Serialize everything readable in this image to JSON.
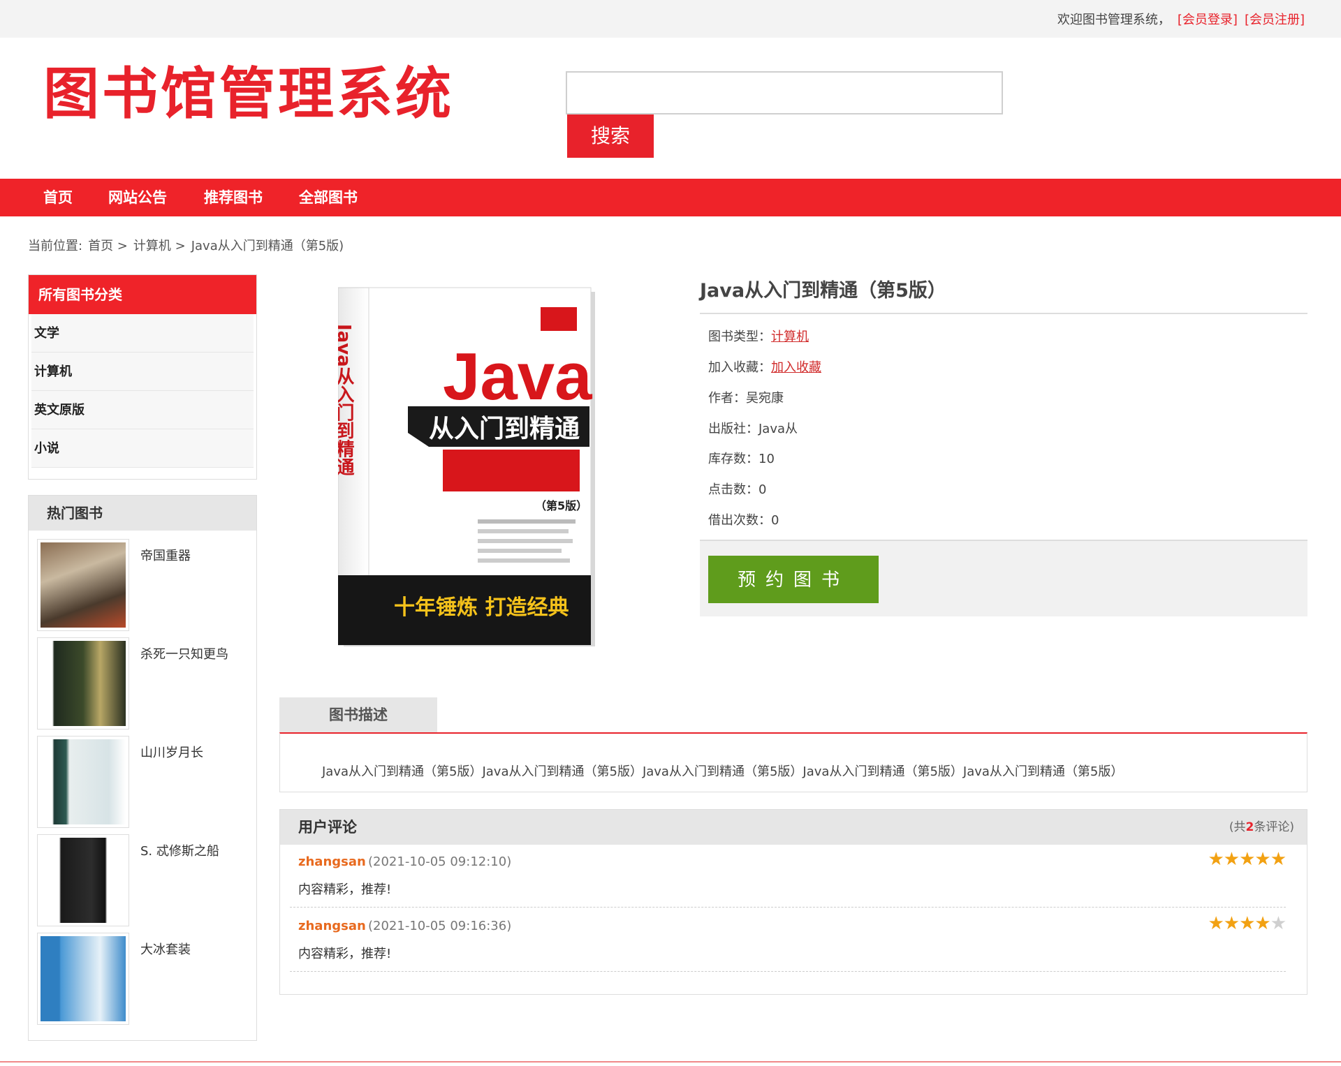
{
  "topbar": {
    "welcome": "欢迎图书管理系统，",
    "login": "[会员登录]",
    "register": "[会员注册]"
  },
  "header": {
    "logo_text": "图书馆管理系统",
    "search_placeholder": "",
    "search_button": "搜索"
  },
  "nav": {
    "items": [
      "首页",
      "网站公告",
      "推荐图书",
      "全部图书"
    ]
  },
  "breadcrumb": {
    "prefix": "当前位置:",
    "items": [
      "首页 >",
      "计算机 >",
      "Java从入门到精通（第5版)"
    ]
  },
  "sidebar": {
    "categories_title": "所有图书分类",
    "categories": [
      "文学",
      "计算机",
      "英文原版",
      "小说"
    ],
    "hot_title": "热门图书",
    "hot_books": [
      "帝国重器",
      "杀死一只知更鸟",
      "山川岁月长",
      "S. 忒修斯之船",
      "大冰套装"
    ]
  },
  "book": {
    "title": "Java从入门到精通（第5版）",
    "type_label": "图书类型：",
    "type_value": "计算机",
    "fav_label": "加入收藏：",
    "fav_value": "加入收藏",
    "author": "作者：吴宛康",
    "publisher": "出版社：Java从",
    "stock": "库存数：10",
    "clicks": "点击数：0",
    "borrows": "借出次数：0",
    "reserve_button": "预约图书",
    "cover_title": "Java",
    "cover_subtitle": "从入门到精通",
    "cover_spine": "Java从入门到精通",
    "cover_edition": "（第5版）",
    "cover_slogan": "十年锤炼 打造经典"
  },
  "description": {
    "tab": "图书描述",
    "text": "Java从入门到精通（第5版）Java从入门到精通（第5版）Java从入门到精通（第5版）Java从入门到精通（第5版）Java从入门到精通（第5版）"
  },
  "comments": {
    "title": "用户评论",
    "count_prefix": "(共",
    "count": "2",
    "count_suffix": "条评论)",
    "items": [
      {
        "user": "zhangsan",
        "time": "(2021-10-05 09:12:10)",
        "text": "内容精彩，推荐!",
        "rating": 5
      },
      {
        "user": "zhangsan",
        "time": "(2021-10-05 09:16:36)",
        "text": "内容精彩，推荐!",
        "rating": 4
      }
    ]
  },
  "colors": {
    "brand_red": "#ef2329",
    "reserve_green": "#5f9c1c",
    "star": "#f2a112"
  }
}
